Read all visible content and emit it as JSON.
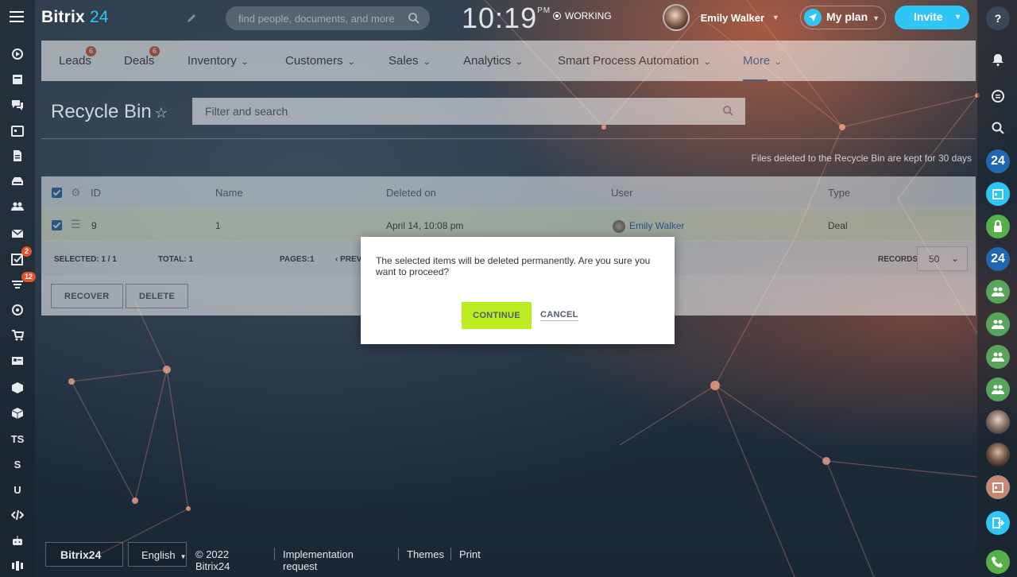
{
  "app": {
    "logo_main": "Bitrix",
    "logo_num": "24"
  },
  "header": {
    "search_placeholder": "find people, documents, and more",
    "clock": "10:19",
    "ampm": "PM",
    "status": "WORKING",
    "user_name": "Emily Walker",
    "plan_label": "My plan",
    "invite_label": "Invite"
  },
  "nav": {
    "tabs": [
      {
        "label": "Leads",
        "badge": "6"
      },
      {
        "label": "Deals",
        "badge": "6"
      },
      {
        "label": "Inventory"
      },
      {
        "label": "Customers"
      },
      {
        "label": "Sales"
      },
      {
        "label": "Analytics"
      },
      {
        "label": "Smart Process Automation"
      },
      {
        "label": "More"
      }
    ]
  },
  "page": {
    "title": "Recycle Bin",
    "filter_placeholder": "Filter and search",
    "retention_note": "Files deleted to the Recycle Bin are kept for 30 days"
  },
  "grid": {
    "columns": [
      "ID",
      "Name",
      "Deleted on",
      "User",
      "Type"
    ],
    "rows": [
      {
        "id": "9",
        "name": "1",
        "deleted_on": "April 14, 10:08 pm",
        "user": "Emily Walker",
        "type": "Deal"
      }
    ],
    "footer": {
      "selected": "SELECTED: 1 / 1",
      "total": "TOTAL: 1",
      "pages_label": "PAGES:",
      "pages_value": "1",
      "prev": "PREV",
      "records_label": "RECORDS:",
      "records_value": "50"
    },
    "actions": {
      "recover": "RECOVER",
      "delete": "DELETE"
    }
  },
  "dialog": {
    "message": "The selected items will be deleted permanently. Are you sure you want to proceed?",
    "continue": "CONTINUE",
    "cancel": "CANCEL"
  },
  "left_rail": {
    "badges": {
      "tasks": "2",
      "feed": "12"
    },
    "text_items": [
      "TS",
      "S",
      "U"
    ]
  },
  "right_rail": {
    "items": [
      "24",
      "24"
    ]
  },
  "footer": {
    "logo": "Bitrix24",
    "language": "English",
    "copyright": "© 2022 Bitrix24",
    "links": [
      "Implementation request",
      "Themes",
      "Print"
    ]
  },
  "colors": {
    "accent": "#2fc6f6",
    "continue_button": "#bbed21",
    "badge": "#e4532e",
    "link": "#2067b0"
  }
}
